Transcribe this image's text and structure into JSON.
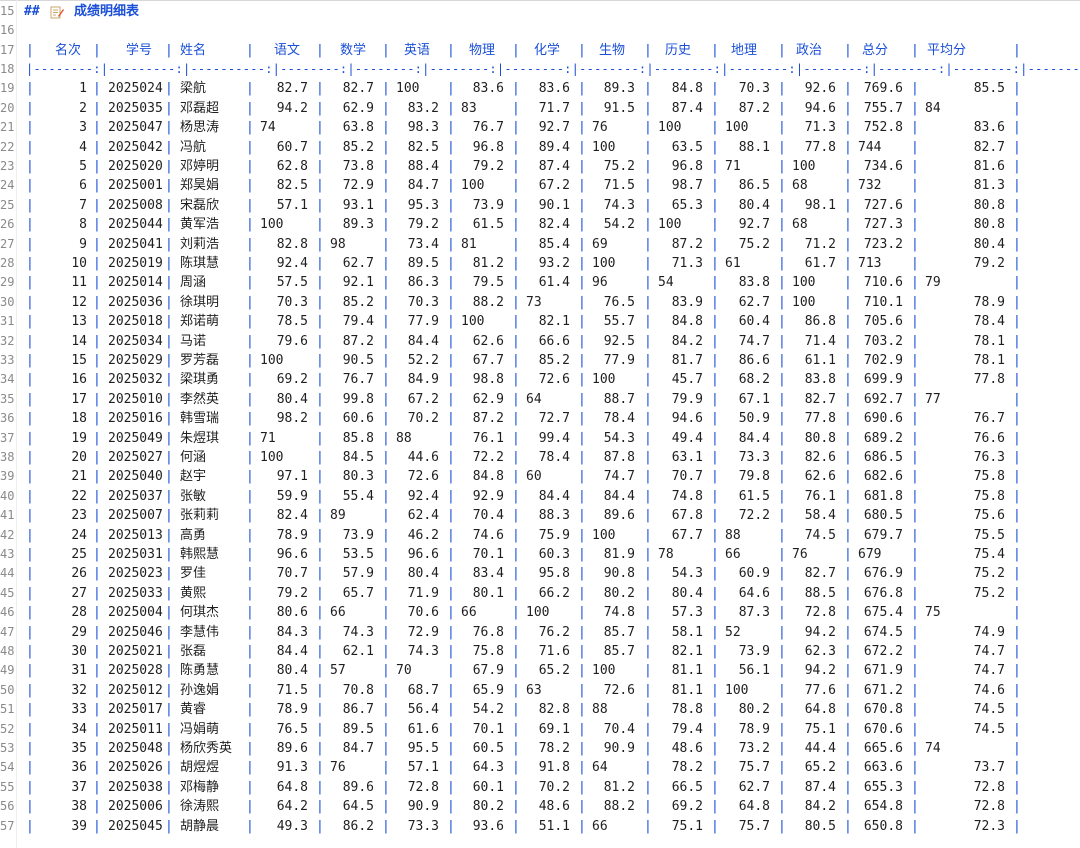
{
  "first_line_number": 15,
  "heading": {
    "marker": "##",
    "title": "成绩明细表"
  },
  "table": {
    "headers": [
      "名次",
      "学号",
      "姓名",
      "语文",
      "数学",
      "英语",
      "物理",
      "化学",
      "生物",
      "历史",
      "地理",
      "政治",
      "总分",
      "平均分"
    ],
    "separator": "|--------:|---------:|----------:|--------:|--------:|--------:|--------:|--------:|--------:|--------:|--------:|--------:|--------:|----------:|",
    "rows": [
      [
        "1",
        "2025024",
        "梁航",
        "82.7",
        "82.7",
        "100",
        "83.6",
        "83.6",
        "89.3",
        "84.8",
        "70.3",
        "92.6",
        "769.6",
        "85.5"
      ],
      [
        "2",
        "2025035",
        "邓磊超",
        "94.2",
        "62.9",
        "83.2",
        "83",
        "71.7",
        "91.5",
        "87.4",
        "87.2",
        "94.6",
        "755.7",
        "84"
      ],
      [
        "3",
        "2025047",
        "杨思涛",
        "74",
        "63.8",
        "98.3",
        "76.7",
        "92.7",
        "76",
        "100",
        "100",
        "71.3",
        "752.8",
        "83.6"
      ],
      [
        "4",
        "2025042",
        "冯航",
        "60.7",
        "85.2",
        "82.5",
        "96.8",
        "89.4",
        "100",
        "63.5",
        "88.1",
        "77.8",
        "744",
        "82.7"
      ],
      [
        "5",
        "2025020",
        "邓婷明",
        "62.8",
        "73.8",
        "88.4",
        "79.2",
        "87.4",
        "75.2",
        "96.8",
        "71",
        "100",
        "734.6",
        "81.6"
      ],
      [
        "6",
        "2025001",
        "郑昊娟",
        "82.5",
        "72.9",
        "84.7",
        "100",
        "67.2",
        "71.5",
        "98.7",
        "86.5",
        "68",
        "732",
        "81.3"
      ],
      [
        "7",
        "2025008",
        "宋磊欣",
        "57.1",
        "93.1",
        "95.3",
        "73.9",
        "90.1",
        "74.3",
        "65.3",
        "80.4",
        "98.1",
        "727.6",
        "80.8"
      ],
      [
        "8",
        "2025044",
        "黄军浩",
        "100",
        "89.3",
        "79.2",
        "61.5",
        "82.4",
        "54.2",
        "100",
        "92.7",
        "68",
        "727.3",
        "80.8"
      ],
      [
        "9",
        "2025041",
        "刘莉浩",
        "82.8",
        "98",
        "73.4",
        "81",
        "85.4",
        "69",
        "87.2",
        "75.2",
        "71.2",
        "723.2",
        "80.4"
      ],
      [
        "10",
        "2025019",
        "陈琪慧",
        "92.4",
        "62.7",
        "89.5",
        "81.2",
        "93.2",
        "100",
        "71.3",
        "61",
        "61.7",
        "713",
        "79.2"
      ],
      [
        "11",
        "2025014",
        "周涵",
        "57.5",
        "92.1",
        "86.3",
        "79.5",
        "61.4",
        "96",
        "54",
        "83.8",
        "100",
        "710.6",
        "79"
      ],
      [
        "12",
        "2025036",
        "徐琪明",
        "70.3",
        "85.2",
        "70.3",
        "88.2",
        "73",
        "76.5",
        "83.9",
        "62.7",
        "100",
        "710.1",
        "78.9"
      ],
      [
        "13",
        "2025018",
        "郑诺萌",
        "78.5",
        "79.4",
        "77.9",
        "100",
        "82.1",
        "55.7",
        "84.8",
        "60.4",
        "86.8",
        "705.6",
        "78.4"
      ],
      [
        "14",
        "2025034",
        "马诺",
        "79.6",
        "87.2",
        "84.4",
        "62.6",
        "66.6",
        "92.5",
        "84.2",
        "74.7",
        "71.4",
        "703.2",
        "78.1"
      ],
      [
        "15",
        "2025029",
        "罗芳磊",
        "100",
        "90.5",
        "52.2",
        "67.7",
        "85.2",
        "77.9",
        "81.7",
        "86.6",
        "61.1",
        "702.9",
        "78.1"
      ],
      [
        "16",
        "2025032",
        "梁琪勇",
        "69.2",
        "76.7",
        "84.9",
        "98.8",
        "72.6",
        "100",
        "45.7",
        "68.2",
        "83.8",
        "699.9",
        "77.8"
      ],
      [
        "17",
        "2025010",
        "李然英",
        "80.4",
        "99.8",
        "67.2",
        "62.9",
        "64",
        "88.7",
        "79.9",
        "67.1",
        "82.7",
        "692.7",
        "77"
      ],
      [
        "18",
        "2025016",
        "韩雪瑞",
        "98.2",
        "60.6",
        "70.2",
        "87.2",
        "72.7",
        "78.4",
        "94.6",
        "50.9",
        "77.8",
        "690.6",
        "76.7"
      ],
      [
        "19",
        "2025049",
        "朱煜琪",
        "71",
        "85.8",
        "88",
        "76.1",
        "99.4",
        "54.3",
        "49.4",
        "84.4",
        "80.8",
        "689.2",
        "76.6"
      ],
      [
        "20",
        "2025027",
        "何涵",
        "100",
        "84.5",
        "44.6",
        "72.2",
        "78.4",
        "87.8",
        "63.1",
        "73.3",
        "82.6",
        "686.5",
        "76.3"
      ],
      [
        "21",
        "2025040",
        "赵宇",
        "97.1",
        "80.3",
        "72.6",
        "84.8",
        "60",
        "74.7",
        "70.7",
        "79.8",
        "62.6",
        "682.6",
        "75.8"
      ],
      [
        "22",
        "2025037",
        "张敏",
        "59.9",
        "55.4",
        "92.4",
        "92.9",
        "84.4",
        "84.4",
        "74.8",
        "61.5",
        "76.1",
        "681.8",
        "75.8"
      ],
      [
        "23",
        "2025007",
        "张莉莉",
        "82.4",
        "89",
        "62.4",
        "70.4",
        "88.3",
        "89.6",
        "67.8",
        "72.2",
        "58.4",
        "680.5",
        "75.6"
      ],
      [
        "24",
        "2025013",
        "高勇",
        "78.9",
        "73.9",
        "46.2",
        "74.6",
        "75.9",
        "100",
        "67.7",
        "88",
        "74.5",
        "679.7",
        "75.5"
      ],
      [
        "25",
        "2025031",
        "韩熙慧",
        "96.6",
        "53.5",
        "96.6",
        "70.1",
        "60.3",
        "81.9",
        "78",
        "66",
        "76",
        "679",
        "75.4"
      ],
      [
        "26",
        "2025023",
        "罗佳",
        "70.7",
        "57.9",
        "80.4",
        "83.4",
        "95.8",
        "90.8",
        "54.3",
        "60.9",
        "82.7",
        "676.9",
        "75.2"
      ],
      [
        "27",
        "2025033",
        "黄熙",
        "79.2",
        "65.7",
        "71.9",
        "80.1",
        "66.2",
        "80.2",
        "80.4",
        "64.6",
        "88.5",
        "676.8",
        "75.2"
      ],
      [
        "28",
        "2025004",
        "何琪杰",
        "80.6",
        "66",
        "70.6",
        "66",
        "100",
        "74.8",
        "57.3",
        "87.3",
        "72.8",
        "675.4",
        "75"
      ],
      [
        "29",
        "2025046",
        "李慧伟",
        "84.3",
        "74.3",
        "72.9",
        "76.8",
        "76.2",
        "85.7",
        "58.1",
        "52",
        "94.2",
        "674.5",
        "74.9"
      ],
      [
        "30",
        "2025021",
        "张磊",
        "84.4",
        "62.1",
        "74.3",
        "75.8",
        "71.6",
        "85.7",
        "82.1",
        "73.9",
        "62.3",
        "672.2",
        "74.7"
      ],
      [
        "31",
        "2025028",
        "陈勇慧",
        "80.4",
        "57",
        "70",
        "67.9",
        "65.2",
        "100",
        "81.1",
        "56.1",
        "94.2",
        "671.9",
        "74.7"
      ],
      [
        "32",
        "2025012",
        "孙逸娟",
        "71.5",
        "70.8",
        "68.7",
        "65.9",
        "63",
        "72.6",
        "81.1",
        "100",
        "77.6",
        "671.2",
        "74.6"
      ],
      [
        "33",
        "2025017",
        "黄睿",
        "78.9",
        "86.7",
        "56.4",
        "54.2",
        "82.8",
        "88",
        "78.8",
        "80.2",
        "64.8",
        "670.8",
        "74.5"
      ],
      [
        "34",
        "2025011",
        "冯娟萌",
        "76.5",
        "89.5",
        "61.6",
        "70.1",
        "69.1",
        "70.4",
        "79.4",
        "78.9",
        "75.1",
        "670.6",
        "74.5"
      ],
      [
        "35",
        "2025048",
        "杨欣秀英",
        "89.6",
        "84.7",
        "95.5",
        "60.5",
        "78.2",
        "90.9",
        "48.6",
        "73.2",
        "44.4",
        "665.6",
        "74"
      ],
      [
        "36",
        "2025026",
        "胡煜煜",
        "91.3",
        "76",
        "57.1",
        "64.3",
        "91.8",
        "64",
        "78.2",
        "75.7",
        "65.2",
        "663.6",
        "73.7"
      ],
      [
        "37",
        "2025038",
        "邓梅静",
        "64.8",
        "89.6",
        "72.8",
        "60.1",
        "70.2",
        "81.2",
        "66.5",
        "62.7",
        "87.4",
        "655.3",
        "72.8"
      ],
      [
        "38",
        "2025006",
        "徐涛熙",
        "64.2",
        "64.5",
        "90.9",
        "80.2",
        "48.6",
        "88.2",
        "69.2",
        "64.8",
        "84.2",
        "654.8",
        "72.8"
      ],
      [
        "39",
        "2025045",
        "胡静晨",
        "49.3",
        "86.2",
        "73.3",
        "93.6",
        "51.1",
        "66",
        "75.1",
        "75.7",
        "80.5",
        "650.8",
        "72.3"
      ]
    ]
  }
}
